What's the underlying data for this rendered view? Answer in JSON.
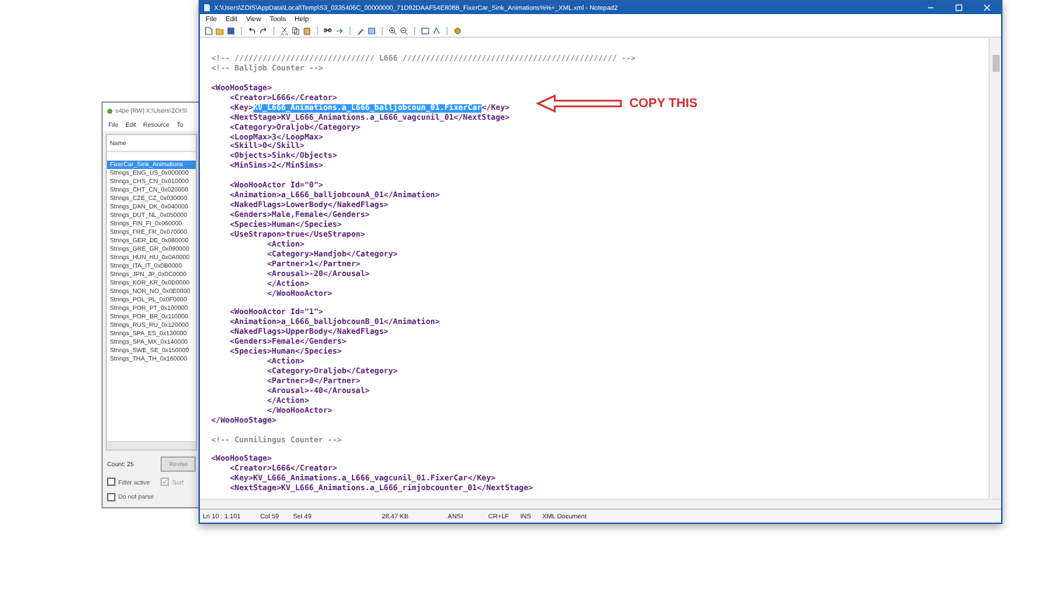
{
  "background_window": {
    "title": "s4pe [RW] X:\\Users\\ZOIS\\",
    "menu": [
      "File",
      "Edit",
      "Resource",
      "To"
    ],
    "column_header": "Name",
    "items": [
      {
        "label": "FixerCar_Sink_Animations",
        "selected": true
      },
      {
        "label": "Strings_ENG_US_0x000000",
        "selected": false
      },
      {
        "label": "Strings_CHS_CN_0x010000",
        "selected": false
      },
      {
        "label": "Strings_CHT_CN_0x020000",
        "selected": false
      },
      {
        "label": "Strings_CZE_CZ_0x030000",
        "selected": false
      },
      {
        "label": "Strings_DAN_DK_0x040000",
        "selected": false
      },
      {
        "label": "Strings_DUT_NL_0x050000",
        "selected": false
      },
      {
        "label": "Strings_FIN_FI_0x060000",
        "selected": false
      },
      {
        "label": "Strings_FRE_FR_0x070000",
        "selected": false
      },
      {
        "label": "Strings_GER_DE_0x080000",
        "selected": false
      },
      {
        "label": "Strings_GRE_GR_0x090000",
        "selected": false
      },
      {
        "label": "Strings_HUN_HU_0x0A0000",
        "selected": false
      },
      {
        "label": "Strings_ITA_IT_0x0B0000",
        "selected": false
      },
      {
        "label": "Strings_JPN_JP_0x0C0000",
        "selected": false
      },
      {
        "label": "Strings_KOR_KR_0x0D0000",
        "selected": false
      },
      {
        "label": "Strings_NOR_NO_0x0E0000",
        "selected": false
      },
      {
        "label": "Strings_POL_PL_0x0F0000",
        "selected": false
      },
      {
        "label": "Strings_POR_PT_0x100000",
        "selected": false
      },
      {
        "label": "Strings_POR_BR_0x110000",
        "selected": false
      },
      {
        "label": "Strings_RUS_RU_0x120000",
        "selected": false
      },
      {
        "label": "Strings_SPA_ES_0x130000",
        "selected": false
      },
      {
        "label": "Strings_SPA_MX_0x140000",
        "selected": false
      },
      {
        "label": "Strings_SWE_SE_0x150000",
        "selected": false
      },
      {
        "label": "Strings_THA_TH_0x160000",
        "selected": false
      }
    ],
    "count": "Count:   25",
    "buttons": [
      "Revise"
    ],
    "checkboxes": [
      {
        "label": "Filter active",
        "checked": false,
        "disabled": false
      },
      {
        "label": "Sort",
        "checked": true,
        "disabled": true
      },
      {
        "label": "Do not parse",
        "checked": false,
        "disabled": false
      }
    ]
  },
  "notepad": {
    "title": "X:\\Users\\ZOIS\\AppData\\Local\\Temp\\S3_0335406C_00000000_71D92DAAF54E808B_FixerCar_Sink_Animations%%+_XML.xml - Notepad2",
    "menu": [
      "File",
      "Edit",
      "View",
      "Tools",
      "Help"
    ],
    "lines": [
      {
        "kind": "comment",
        "text": "<!-- ////////////////////////////// L666 ////////////////////////////////////////////// -->"
      },
      {
        "kind": "comment",
        "text": "<!-- Balljob Counter -->"
      },
      {
        "kind": "blank"
      },
      {
        "kind": "code",
        "text": "<WooHooStage>"
      },
      {
        "kind": "code",
        "text": "    <Creator>L666</Creator>"
      },
      {
        "kind": "code",
        "segments": [
          {
            "text": "    <Key>",
            "selected": false
          },
          {
            "text": "KV_L666_Animations.a_L666_balljobcoun_01.FixerCar",
            "selected": true
          },
          {
            "text": "</Key>",
            "selected": false
          }
        ]
      },
      {
        "kind": "code",
        "text": "    <NextStage>KV_L666_Animations.a_L666_vagcunil_01</NextStage>"
      },
      {
        "kind": "code",
        "text": "    <Category>Oraljob</Category>"
      },
      {
        "kind": "code",
        "text": "    <LoopMax>3</LoopMax>"
      },
      {
        "kind": "code",
        "text": "    <Skill>0</Skill>"
      },
      {
        "kind": "code",
        "text": "    <Objects>Sink</Objects>"
      },
      {
        "kind": "code",
        "text": "    <MinSims>2</MinSims>"
      },
      {
        "kind": "blank"
      },
      {
        "kind": "code",
        "text": "    <WooHooActor Id=\"0\">"
      },
      {
        "kind": "code",
        "text": "    <Animation>a_L666_balljobcounA_01</Animation>"
      },
      {
        "kind": "code",
        "text": "    <NakedFlags>LowerBody</NakedFlags>"
      },
      {
        "kind": "code",
        "text": "    <Genders>Male,Female</Genders>"
      },
      {
        "kind": "code",
        "text": "    <Species>Human</Species>"
      },
      {
        "kind": "code",
        "text": "    <UseStrapon>true</UseStrapon>"
      },
      {
        "kind": "code",
        "text": "            <Action>"
      },
      {
        "kind": "code",
        "text": "            <Category>Handjob</Category>"
      },
      {
        "kind": "code",
        "text": "            <Partner>1</Partner>"
      },
      {
        "kind": "code",
        "text": "            <Arousal>-20</Arousal>"
      },
      {
        "kind": "code",
        "text": "            </Action>"
      },
      {
        "kind": "code",
        "text": "            </WooHooActor>"
      },
      {
        "kind": "blank"
      },
      {
        "kind": "code",
        "text": "    <WooHooActor Id=\"1\">"
      },
      {
        "kind": "code",
        "text": "    <Animation>a_L666_balljobcounB_01</Animation>"
      },
      {
        "kind": "code",
        "text": "    <NakedFlags>UpperBody</NakedFlags>"
      },
      {
        "kind": "code",
        "text": "    <Genders>Female</Genders>"
      },
      {
        "kind": "code",
        "text": "    <Species>Human</Species>"
      },
      {
        "kind": "code",
        "text": "            <Action>"
      },
      {
        "kind": "code",
        "text": "            <Category>Oraljob</Category>"
      },
      {
        "kind": "code",
        "text": "            <Partner>0</Partner>"
      },
      {
        "kind": "code",
        "text": "            <Arousal>-40</Arousal>"
      },
      {
        "kind": "code",
        "text": "            </Action>"
      },
      {
        "kind": "code",
        "text": "            </WooHooActor>"
      },
      {
        "kind": "code",
        "text": "</WooHooStage>"
      },
      {
        "kind": "blank"
      },
      {
        "kind": "comment",
        "text": "<!-- Cunnilingus Counter -->"
      },
      {
        "kind": "blank"
      },
      {
        "kind": "code",
        "text": "<WooHooStage>"
      },
      {
        "kind": "code",
        "text": "    <Creator>L666</Creator>"
      },
      {
        "kind": "code",
        "text": "    <Key>KV_L666_Animations.a_L666_vagcunil_01.FixerCar</Key>"
      },
      {
        "kind": "code",
        "text": "    <NextStage>KV_L666_Animations.a_L666_rimjobcounter_01</NextStage>"
      }
    ],
    "status_bar": [
      "Ln 10 : 1.101",
      "Col 59",
      "Sel 49",
      "28,47 KB",
      "ANSI",
      "CR+LF",
      "INS",
      "XML Document"
    ]
  },
  "annotation": {
    "label": "COPY THIS"
  }
}
